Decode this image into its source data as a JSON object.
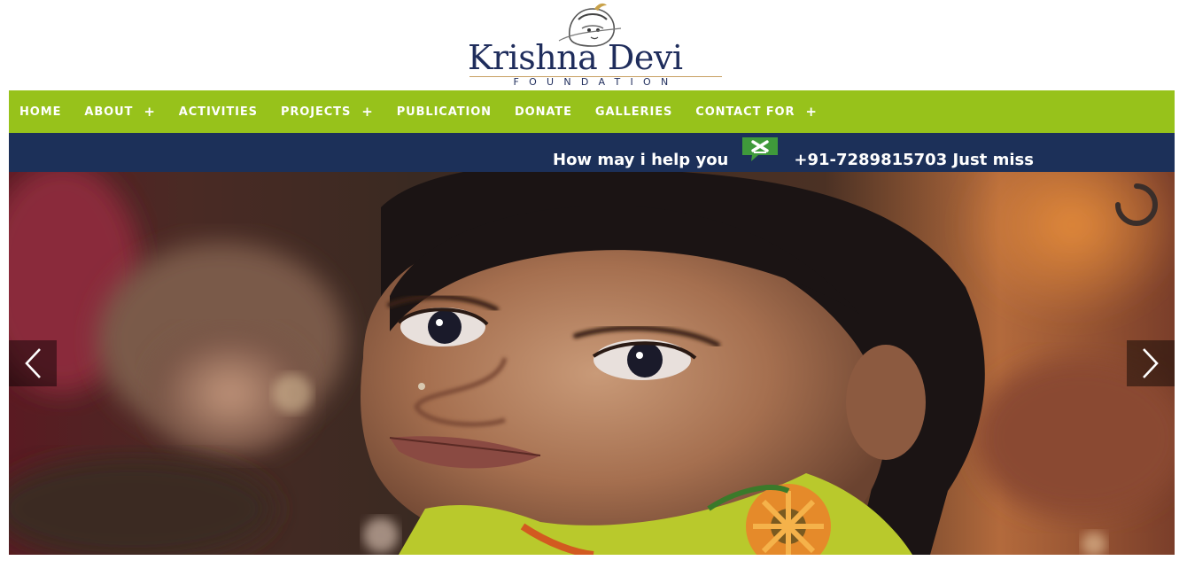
{
  "logo": {
    "title": "Krishna Devi",
    "subtitle": "FOUNDATION",
    "emblem_icon": "krishna-emblem-icon"
  },
  "nav": {
    "items": [
      {
        "label": "HOME",
        "has_submenu": false
      },
      {
        "label": "ABOUT",
        "has_submenu": true
      },
      {
        "label": "ACTIVITIES",
        "has_submenu": false
      },
      {
        "label": "PROJECTS",
        "has_submenu": true
      },
      {
        "label": "PUBLICATION",
        "has_submenu": false
      },
      {
        "label": "DONATE",
        "has_submenu": false
      },
      {
        "label": "GALLERIES",
        "has_submenu": false
      },
      {
        "label": "CONTACT FOR",
        "has_submenu": true
      }
    ],
    "submenu_indicator": "+"
  },
  "marquee": {
    "text_before": "How may i help you",
    "icon": "whatsapp-icon",
    "text_after": "+91-7289815703 Just miss"
  },
  "hero": {
    "image": "girl-portrait-photo",
    "prev_icon": "chevron-left-icon",
    "next_icon": "chevron-right-icon",
    "loader_icon": "loading-spinner-icon"
  },
  "colors": {
    "nav_bg": "#97c21b",
    "marquee_bg": "#1c3059",
    "logo_text": "#1f2d5c",
    "whatsapp_green": "#3f9a3b"
  }
}
